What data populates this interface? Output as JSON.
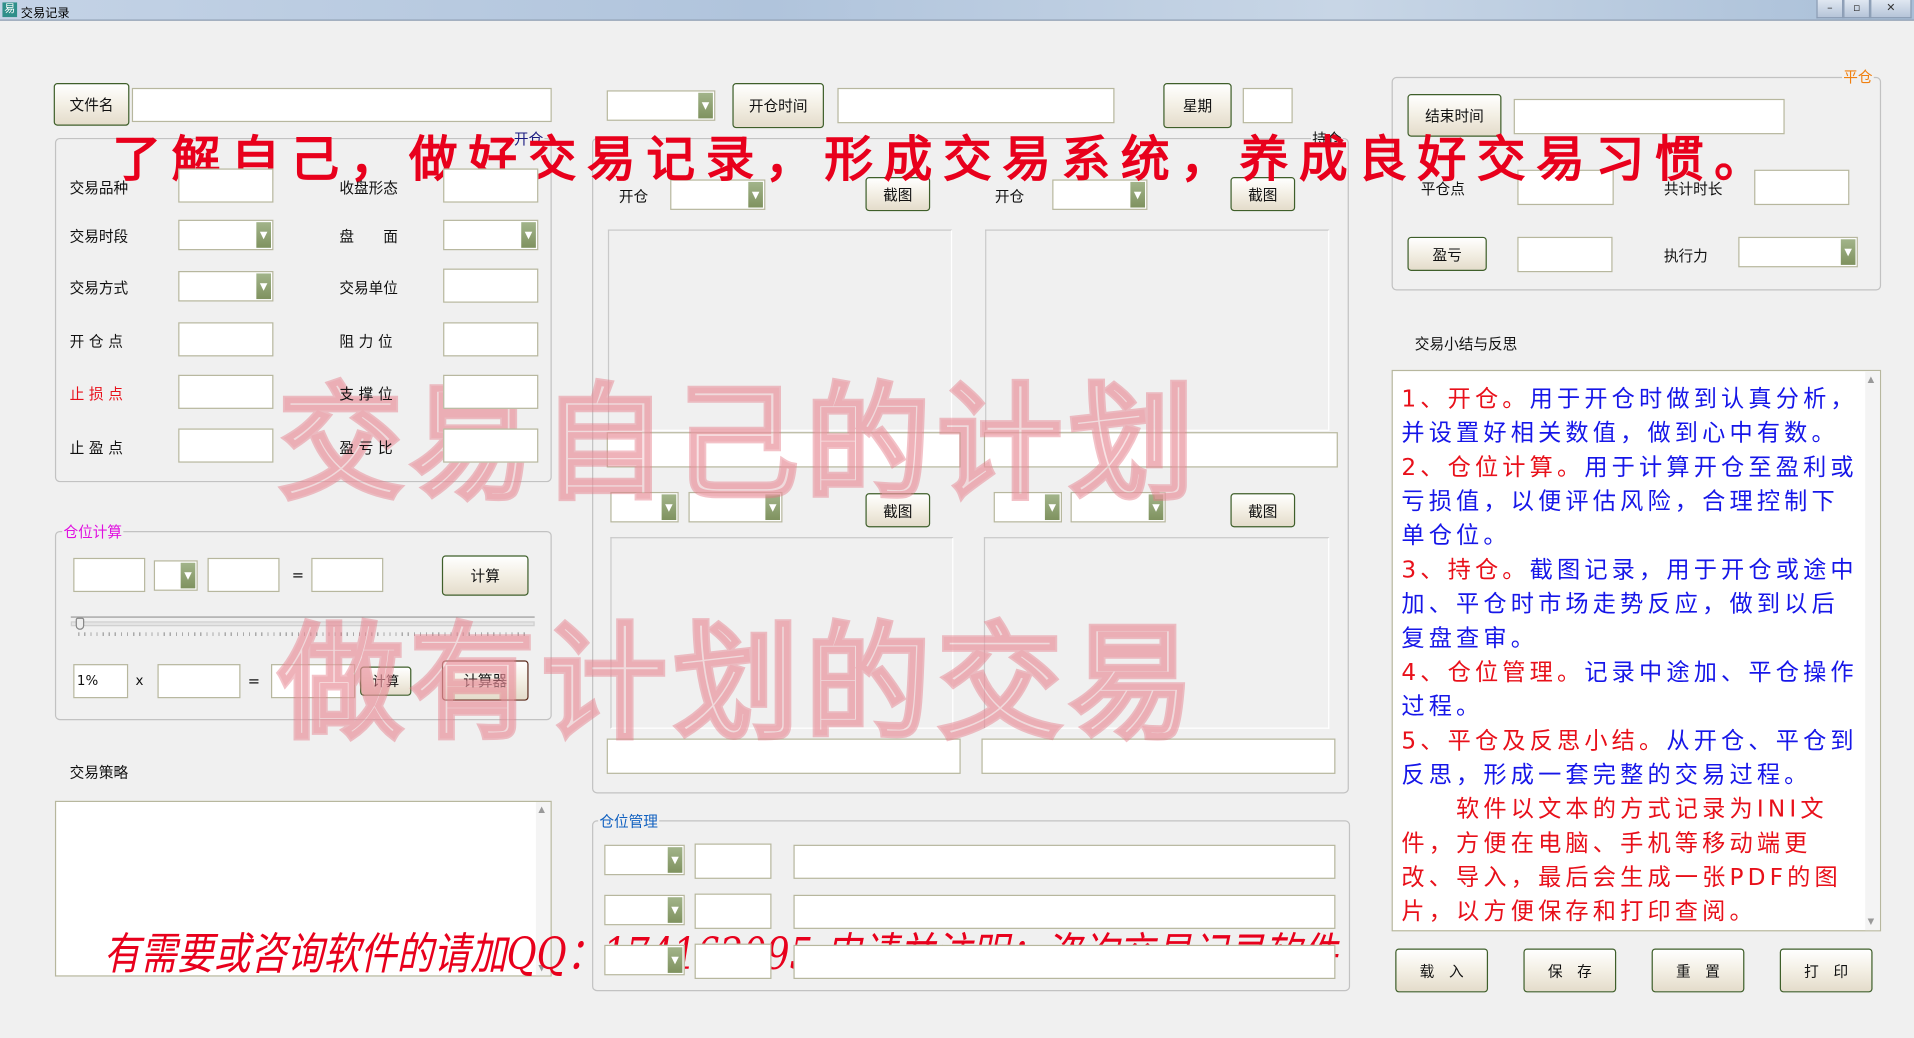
{
  "window": {
    "title": "交易记录",
    "app_icon": "易",
    "minimize": "–",
    "restore": "▫",
    "close": "✕"
  },
  "top": {
    "file_button": "文件名",
    "file_value": "",
    "open_time_button": "开仓时间",
    "open_time_value": "",
    "weekday_button": "星期",
    "weekday_value": ""
  },
  "open_group": {
    "label": "开仓",
    "left_rows": [
      {
        "label": "交易品种",
        "type": "input"
      },
      {
        "label": "交易时段",
        "type": "combo"
      },
      {
        "label": "交易方式",
        "type": "combo"
      },
      {
        "label": "开 仓 点",
        "type": "input"
      },
      {
        "label": "止 损 点",
        "type": "input",
        "color": "#e8101a"
      },
      {
        "label": "止 盈 点",
        "type": "input"
      }
    ],
    "right_rows": [
      {
        "label": "收盘形态",
        "type": "input"
      },
      {
        "label": "盘　　面",
        "type": "combo"
      },
      {
        "label": "交易单位",
        "type": "input"
      },
      {
        "label": "阻 力 位",
        "type": "input"
      },
      {
        "label": "支 撑 位",
        "type": "input"
      },
      {
        "label": "盈 亏 比",
        "type": "input"
      }
    ]
  },
  "position_calc": {
    "label": "仓位计算",
    "eq": "=",
    "calc_button": "计算",
    "percent_value": "1%",
    "times": "x",
    "calc_small_button": "计算",
    "calculator_button": "计算器",
    "slider_value": 0
  },
  "strategy": {
    "label": "交易策略",
    "value": ""
  },
  "hold_group": {
    "label": "持仓",
    "open_label_1": "开仓",
    "open_label_2": "开仓",
    "screenshot_button": "截图"
  },
  "manage_group": {
    "label": "仓位管理"
  },
  "close_group": {
    "label": "平仓",
    "end_time_button": "结束时间",
    "close_point_label": "平仓点",
    "total_time_label": "共计时长",
    "pnl_button": "盈亏",
    "execution_label": "执行力"
  },
  "summary": {
    "label": "交易小结与反思",
    "items": [
      {
        "head": "1、开仓。",
        "body": "用于开仓时做到认真分析，并设置好相关数值，做到心中有数。"
      },
      {
        "head": "2、仓位计算。",
        "body": "用于计算开仓至盈利或亏损值，以便评估风险，合理控制下单仓位。"
      },
      {
        "head": "3、持仓。",
        "body": "截图记录，用于开仓或途中加、平仓时市场走势反应，做到以后复盘查审。"
      },
      {
        "head": "4、仓位管理。",
        "body": "记录中途加、平仓操作过程。"
      },
      {
        "head": "5、平仓及反思小结。",
        "body": "从开仓、平仓到反思，形成一套完整的交易过程。"
      }
    ],
    "note": "　　软件以文本的方式记录为INI文件，方便在电脑、手机等移动端更改、导入，最后会生成一张PDF的图片，以方便保存和打印查阅。"
  },
  "bottom_buttons": {
    "load": "载　入",
    "save": "保　存",
    "reset": "重　置",
    "print": "打　印"
  },
  "watermarks": {
    "slogan": "了解自己，做好交易记录，形成交易系统，养成良好交易习惯。",
    "contact": "有需要或咨询软件的请加QQ：174162095 申请并注明：咨询交易记录软件",
    "pink_1": "交易自己的计划",
    "pink_2": "做有计划的交易"
  },
  "colors": {
    "button_border": "#3f5f2a",
    "dropdown": "#8fa070",
    "stop_loss": "#e8101a",
    "calc_label": "#e010e0",
    "manage_label": "#1060c0",
    "close_label": "#f08010",
    "summary_blue": "#1616e8",
    "summary_red": "#e8101a"
  }
}
